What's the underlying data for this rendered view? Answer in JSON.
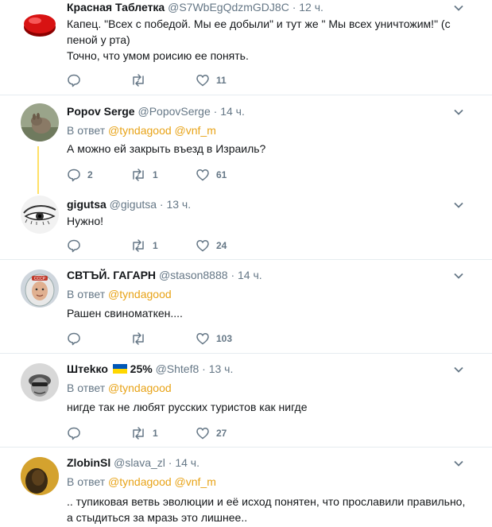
{
  "tweets": [
    {
      "name": "Красная Таблетка",
      "handle": "@S7WbEgQdzmGDJ8C",
      "time": "· 12 ч.",
      "lines": [
        "Капец. \"Всех с победой. Мы ее добыли\" и тут же \" Мы всех уничтожим!\" (с",
        "пеной у рта)",
        "Точно, что умом роисию ее понять."
      ],
      "replies": "",
      "retweets": "",
      "likes": "11"
    },
    {
      "name": "Popov Serge",
      "handle": "@PopovSerge",
      "time": "· 14 ч.",
      "reply_prefix": "В ответ",
      "reply_to": "@tyndagood @vnf_m",
      "lines": [
        "А можно ей закрыть въезд в Израиль?"
      ],
      "replies": "2",
      "retweets": "1",
      "likes": "61"
    },
    {
      "name": "gigutsa",
      "handle": "@gigutsa",
      "time": "· 13 ч.",
      "lines": [
        "Нужно!"
      ],
      "replies": "",
      "retweets": "1",
      "likes": "24"
    },
    {
      "name": "СВТЪЙ. ГАГАРН",
      "handle": "@stason8888",
      "time": "· 14 ч.",
      "reply_prefix": "В ответ",
      "reply_to": "@tyndagood",
      "lines": [
        "Рашен свиноматкен...."
      ],
      "replies": "",
      "retweets": "",
      "likes": "103"
    },
    {
      "name": "Штеkко",
      "name_suffix": "25%",
      "handle": "@Shtef8",
      "time": "· 13 ч.",
      "reply_prefix": "В ответ",
      "reply_to": "@tyndagood",
      "lines": [
        "нигде так не любят русских туристов как нигде"
      ],
      "replies": "",
      "retweets": "1",
      "likes": "27"
    },
    {
      "name": "ZlobinSl",
      "handle": "@slava_zl",
      "time": "· 14 ч.",
      "reply_prefix": "В ответ",
      "reply_to": "@tyndagood @vnf_m",
      "lines": [
        ".. тупиковая ветвь эволюции и её исход понятен, что прославили правильно,",
        "а стыдиться за мразь это лишнее.."
      ]
    }
  ],
  "colors": {
    "accent": "#e8a317",
    "muted": "#657786",
    "flag_blue": "#0057b7",
    "flag_yellow": "#ffd700"
  },
  "icons": [
    "reply-icon",
    "retweet-icon",
    "like-icon",
    "chevron-down-icon"
  ]
}
